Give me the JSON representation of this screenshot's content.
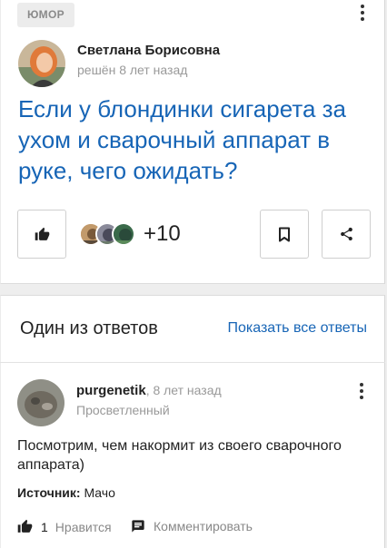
{
  "question": {
    "category": "ЮМОР",
    "author": "Светлана Борисовна",
    "status": "решён 8 лет назад",
    "title": "Если у блондинки сигарета за ухом и сварочный аппарат в руке, чего ожидать?",
    "participants_extra": "+10"
  },
  "answers": {
    "section_title": "Один из ответов",
    "show_all": "Показать все ответы",
    "item": {
      "author": "purgenetik",
      "time": ", 8 лет назад",
      "rank": "Просветленный",
      "text": "Посмотрим, чем накормит из своего сварочного аппарата)",
      "source_label": "Источник:",
      "source_value": " Мачо",
      "likes_count": "1",
      "like_label": "Нравится",
      "comment_label": "Комментировать"
    }
  },
  "icons": [
    "more-vertical-icon",
    "thumbs-up-icon",
    "bookmark-icon",
    "share-icon",
    "comment-icon"
  ],
  "colors": {
    "link": "#1765b6",
    "muted": "#999999",
    "badge_bg": "#ececec"
  }
}
